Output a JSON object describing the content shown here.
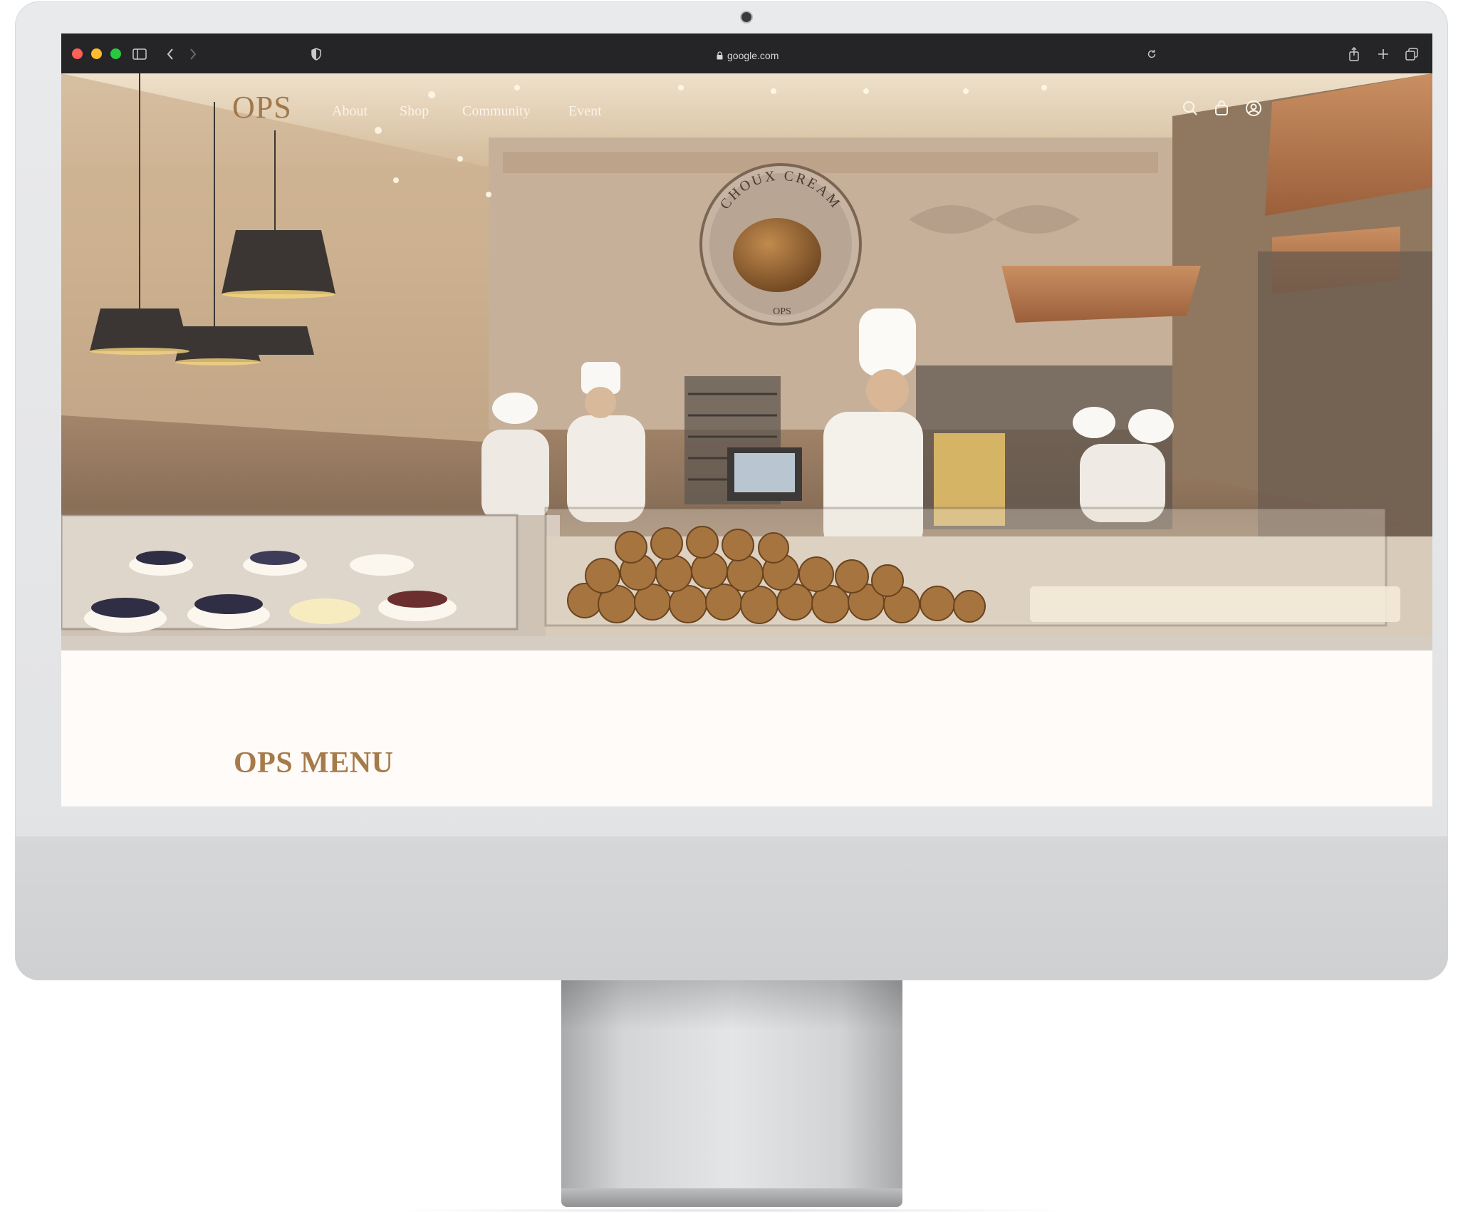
{
  "browser": {
    "url": "google.com"
  },
  "site": {
    "logo": "OPS",
    "nav": [
      {
        "label": "About"
      },
      {
        "label": "Shop"
      },
      {
        "label": "Community"
      },
      {
        "label": "Event"
      }
    ],
    "icons": [
      "search-icon",
      "shopping-bag-icon",
      "account-icon"
    ]
  },
  "hero": {
    "sign_text": "CHOUX CREAM",
    "sign_logo": "OPS"
  },
  "section": {
    "title": "OPS MENU"
  },
  "colors": {
    "brand_gold": "#a67b4a",
    "page_background": "#fffbf8",
    "titlebar": "#252527"
  }
}
